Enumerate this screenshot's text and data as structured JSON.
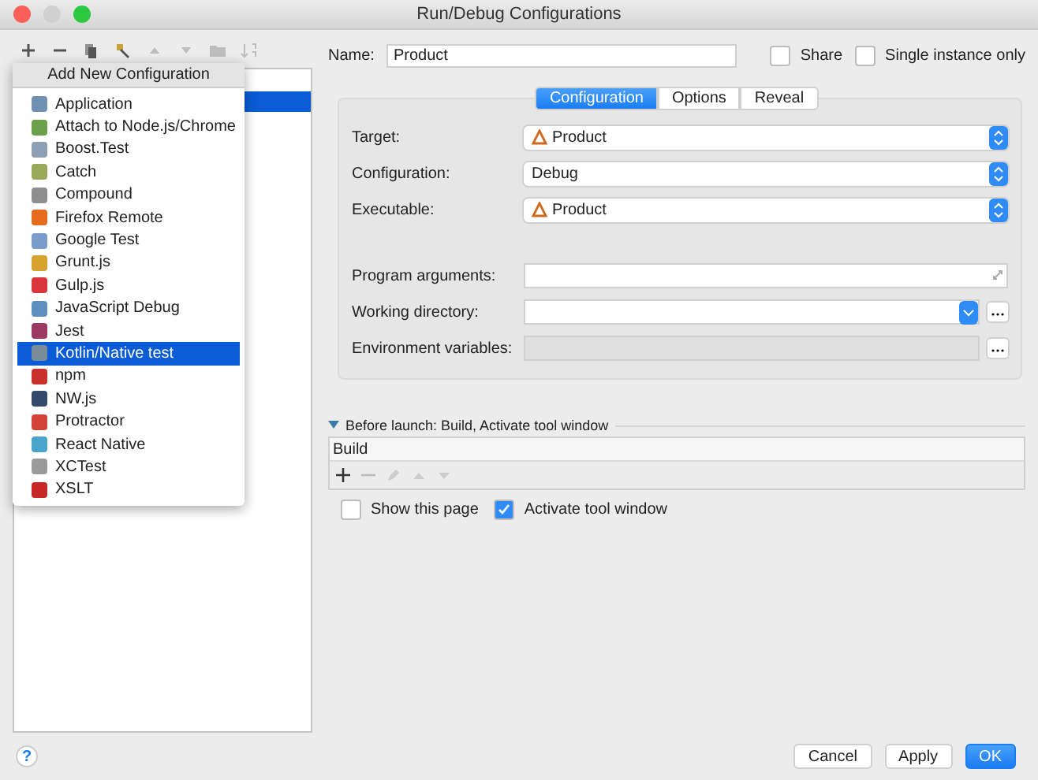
{
  "window": {
    "title": "Run/Debug Configurations"
  },
  "toolbar": [
    {
      "kind": "add",
      "disabled": false
    },
    {
      "kind": "remove",
      "disabled": false
    },
    {
      "kind": "copy",
      "disabled": false
    },
    {
      "kind": "edit",
      "disabled": false
    },
    {
      "kind": "up",
      "disabled": true
    },
    {
      "kind": "down",
      "disabled": true
    },
    {
      "kind": "folder",
      "disabled": true
    },
    {
      "kind": "sort",
      "disabled": true
    }
  ],
  "popup": {
    "title": "Add New Configuration",
    "items": [
      {
        "label": "Application",
        "color": "#6f8fb3",
        "selected": false
      },
      {
        "label": "Attach to Node.js/Chrome",
        "color": "#6ba04a",
        "selected": false
      },
      {
        "label": "Boost.Test",
        "color": "#8c9fb5",
        "selected": false
      },
      {
        "label": "Catch",
        "color": "#9aa85a",
        "selected": false
      },
      {
        "label": "Compound",
        "color": "#8e8e8e",
        "selected": false
      },
      {
        "label": "Firefox Remote",
        "color": "#e66b1f",
        "selected": false
      },
      {
        "label": "Google Test",
        "color": "#7a9ccc",
        "selected": false
      },
      {
        "label": "Grunt.js",
        "color": "#d8a230",
        "selected": false
      },
      {
        "label": "Gulp.js",
        "color": "#d8363a",
        "selected": false
      },
      {
        "label": "JavaScript Debug",
        "color": "#5e8fbf",
        "selected": false
      },
      {
        "label": "Jest",
        "color": "#9b3b62",
        "selected": false
      },
      {
        "label": "Kotlin/Native test",
        "color": "#7c8b9a",
        "selected": true
      },
      {
        "label": "npm",
        "color": "#c9302c",
        "selected": false
      },
      {
        "label": "NW.js",
        "color": "#354a6b",
        "selected": false
      },
      {
        "label": "Protractor",
        "color": "#d2433a",
        "selected": false
      },
      {
        "label": "React Native",
        "color": "#4aa3c8",
        "selected": false
      },
      {
        "label": "XCTest",
        "color": "#9a9a9a",
        "selected": false
      },
      {
        "label": "XSLT",
        "color": "#c62828",
        "selected": false
      }
    ]
  },
  "name": {
    "label": "Name:",
    "value": "Product"
  },
  "options": [
    {
      "label": "Share",
      "checked": false
    },
    {
      "label": "Single instance only",
      "checked": false
    }
  ],
  "tabs": [
    {
      "label": "Configuration",
      "selected": true
    },
    {
      "label": "Options",
      "selected": false
    },
    {
      "label": "Reveal",
      "selected": false
    }
  ],
  "fields": [
    {
      "label": "Target:",
      "kind": "select",
      "value": "Product",
      "app_icon": true
    },
    {
      "label": "Configuration:",
      "kind": "select",
      "value": "Debug",
      "app_icon": false
    },
    {
      "label": "Executable:",
      "kind": "select",
      "value": "Product",
      "app_icon": true
    },
    {
      "label": "Program arguments:",
      "kind": "expand"
    },
    {
      "label": "Working directory:",
      "kind": "combo"
    },
    {
      "label": "Environment variables:",
      "kind": "disabled"
    }
  ],
  "before_launch": {
    "title": "Before launch: Build, Activate tool window",
    "expanded": true,
    "items": [
      "Build"
    ]
  },
  "launch_options": [
    {
      "label": "Show this page",
      "checked": false
    },
    {
      "label": "Activate tool window",
      "checked": true
    }
  ],
  "buttons": [
    {
      "label": "Cancel",
      "primary": false
    },
    {
      "label": "Apply",
      "primary": false
    },
    {
      "label": "OK",
      "primary": true
    }
  ],
  "help": "?"
}
